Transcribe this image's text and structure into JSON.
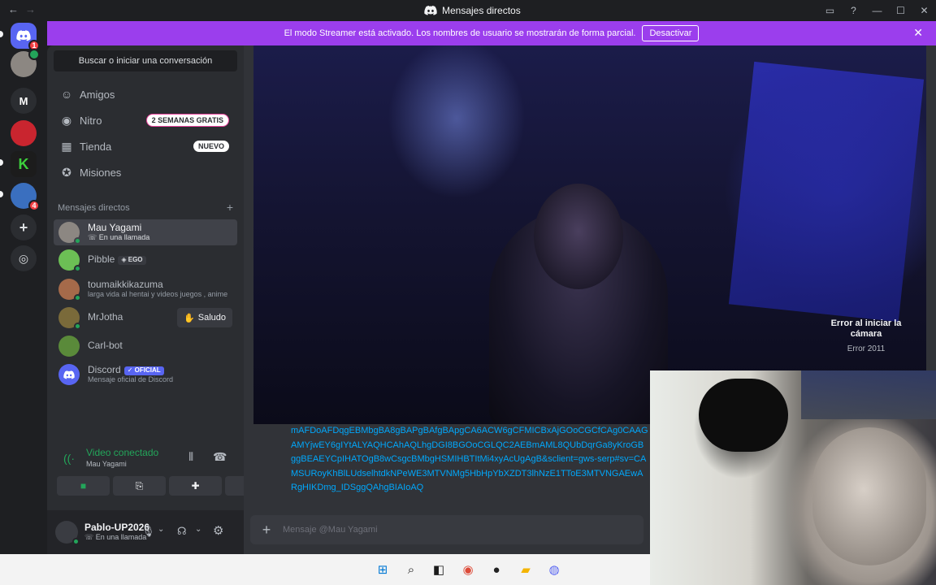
{
  "titlebar": {
    "back": "←",
    "forward": "→",
    "title": "Mensajes directos"
  },
  "banner": {
    "text": "El modo Streamer está activado. Los nombres de usuario se mostrarán de forma parcial.",
    "button": "Desactivar"
  },
  "rail": {
    "home_badge": "1",
    "server_letter": "M",
    "server_badge": "4"
  },
  "sidebar": {
    "search": "Buscar o iniciar una conversación",
    "nav": [
      {
        "label": "Amigos",
        "icon": "friends-icon"
      },
      {
        "label": "Nitro",
        "icon": "nitro-icon",
        "tag": "2 SEMANAS GRATIS"
      },
      {
        "label": "Tienda",
        "icon": "shop-icon",
        "tag": "NUEVO"
      },
      {
        "label": "Misiones",
        "icon": "quests-icon"
      }
    ],
    "dm_header": "Mensajes directos",
    "dms": [
      {
        "name": "Mau Yagami",
        "sub": "En una llamada"
      },
      {
        "name": "Pibble",
        "chip": "EGO"
      },
      {
        "name": "toumaikkikazuma",
        "sub": "larga vida al hentai y videos juegos , anime"
      },
      {
        "name": "MrJotha",
        "action": "Saludo"
      },
      {
        "name": "Carl-bot"
      },
      {
        "name": "Discord",
        "chip": "OFICIAL",
        "sub": "Mensaje oficial de Discord"
      }
    ]
  },
  "voice": {
    "title": "Video conectado",
    "sub": "Mau Yagami"
  },
  "user": {
    "name": "Pablo-UP2026",
    "status": "En una llamada"
  },
  "main": {
    "camera_error_title": "Error al iniciar la cámara",
    "camera_error_code": "Error 2011",
    "message_link": "mAFDoAFDqgEBMbgBA8gBAPgBAfgBApgCA6ACW6gCFMICBxAjGOoCGCfCAg0CAAGAMYjwEY6gIYtALYAQHCAhAQLhgDGI8BGOoCGLQC2AEBmAML8QUbDqrGa8yKroGBggBEAEYCpIHATOgB8wCsgcBMbgHSMIHBTItMi4xyAcUgAgB&sclient=gws-serp#sv=CAMSURoyKhBlLUdselhtdkNPeWE3MTVNMg5HbHpYbXZDT3lhNzE1TToE3MTVNGAEwARgHIKDmg_IDSggQAhgBIAIoAQ",
    "composer_placeholder": "Mensaje @Mau Yagami"
  },
  "colors": {
    "banner": "#9b3eed",
    "online": "#23a55a",
    "link": "#00a8fc",
    "badge": "#f23f43"
  }
}
